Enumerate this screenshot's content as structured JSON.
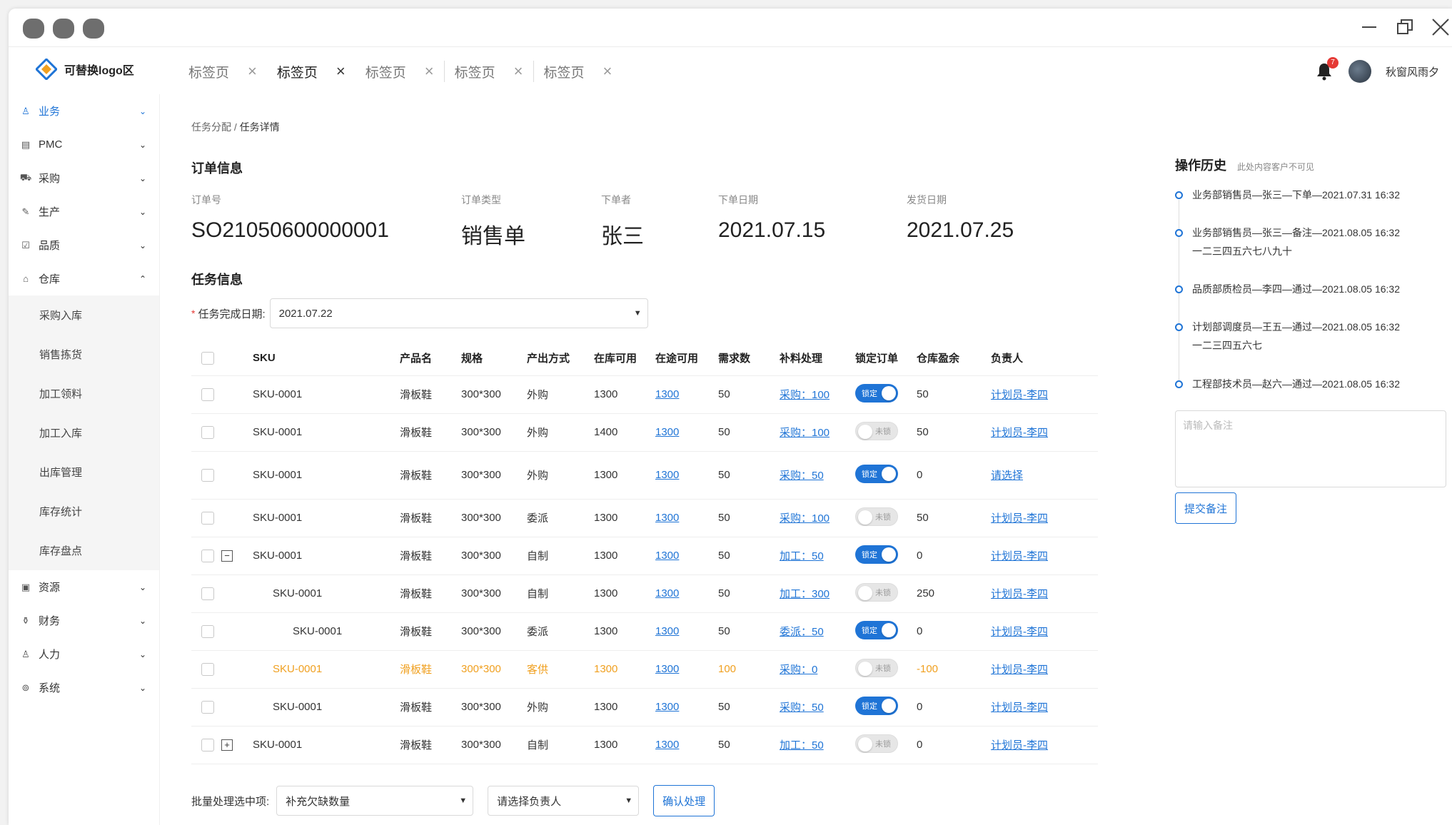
{
  "header": {
    "logo_text": "可替换logo区",
    "tabs": [
      {
        "label": "标签页",
        "active": false
      },
      {
        "label": "标签页",
        "active": true
      },
      {
        "label": "标签页",
        "active": false
      },
      {
        "label": "标签页",
        "active": false
      },
      {
        "label": "标签页",
        "active": false
      }
    ],
    "notification_count": "7",
    "username": "秋窗风雨夕"
  },
  "sidebar": {
    "items": [
      {
        "label": "业务",
        "icon": "user-group-icon"
      },
      {
        "label": "PMC",
        "icon": "pmc-icon"
      },
      {
        "label": "采购",
        "icon": "cart-icon"
      },
      {
        "label": "生产",
        "icon": "tool-icon"
      },
      {
        "label": "品质",
        "icon": "quality-icon"
      },
      {
        "label": "仓库",
        "icon": "warehouse-icon"
      },
      {
        "label": "资源",
        "icon": "resource-icon"
      },
      {
        "label": "财务",
        "icon": "money-icon"
      },
      {
        "label": "人力",
        "icon": "person-icon"
      },
      {
        "label": "系统",
        "icon": "settings-icon"
      }
    ],
    "warehouse_sub": [
      "采购入库",
      "销售拣货",
      "加工领料",
      "加工入库",
      "出库管理",
      "库存统计",
      "库存盘点"
    ]
  },
  "breadcrumb": {
    "parent": "任务分配",
    "sep": "/",
    "current": "任务详情"
  },
  "order": {
    "section_title": "订单信息",
    "labels": {
      "order_no": "订单号",
      "type": "订单类型",
      "orderer": "下单者",
      "order_date": "下单日期",
      "ship_date": "发货日期"
    },
    "values": {
      "order_no": "SO21050600000001",
      "type": "销售单",
      "orderer": "张三",
      "order_date": "2021.07.15",
      "ship_date": "2021.07.25"
    }
  },
  "task": {
    "section_title": "任务信息",
    "required_mark": "*",
    "date_label": "任务完成日期:",
    "date_value": "2021.07.22"
  },
  "table": {
    "headers": [
      "SKU",
      "产品名",
      "规格",
      "产出方式",
      "在库可用",
      "在途可用",
      "需求数",
      "补料处理",
      "锁定订单",
      "仓库盈余",
      "负责人"
    ],
    "lock_on": "锁定",
    "lock_off": "未锁",
    "rows": [
      {
        "sku": "SKU-0001",
        "name": "滑板鞋",
        "spec": "300*300",
        "method": "外购",
        "stock": "1300",
        "transit": "1300",
        "demand": "50",
        "supply": "采购：100",
        "locked": true,
        "surplus": "50",
        "owner": "计划员-李四"
      },
      {
        "sku": "SKU-0001",
        "name": "滑板鞋",
        "spec": "300*300",
        "method": "外购",
        "stock": "1400",
        "transit": "1300",
        "demand": "50",
        "supply": "采购：100",
        "locked": false,
        "surplus": "50",
        "owner": "计划员-李四"
      },
      {
        "sku": "SKU-0001",
        "name": "滑板鞋",
        "spec": "300*300",
        "method": "外购",
        "stock": "1300",
        "transit": "1300",
        "demand": "50",
        "supply": "采购：50",
        "locked": true,
        "surplus": "0",
        "owner": "请选择"
      },
      {
        "sku": "SKU-0001",
        "name": "滑板鞋",
        "spec": "300*300",
        "method": "委派",
        "stock": "1300",
        "transit": "1300",
        "demand": "50",
        "supply": "采购：100",
        "locked": false,
        "surplus": "50",
        "owner": "计划员-李四"
      },
      {
        "sku": "SKU-0001",
        "name": "滑板鞋",
        "spec": "300*300",
        "method": "自制",
        "stock": "1300",
        "transit": "1300",
        "demand": "50",
        "supply": "加工：50",
        "locked": true,
        "surplus": "0",
        "owner": "计划员-李四"
      },
      {
        "sku": "SKU-0001",
        "name": "滑板鞋",
        "spec": "300*300",
        "method": "自制",
        "stock": "1300",
        "transit": "1300",
        "demand": "50",
        "supply": "加工：300",
        "locked": false,
        "surplus": "250",
        "owner": "计划员-李四"
      },
      {
        "sku": "SKU-0001",
        "name": "滑板鞋",
        "spec": "300*300",
        "method": "委派",
        "stock": "1300",
        "transit": "1300",
        "demand": "50",
        "supply": "委派：50",
        "locked": true,
        "surplus": "0",
        "owner": "计划员-李四"
      },
      {
        "sku": "SKU-0001",
        "name": "滑板鞋",
        "spec": "300*300",
        "method": "客供",
        "stock": "1300",
        "transit": "1300",
        "demand": "100",
        "supply": "采购：0",
        "locked": false,
        "surplus": "-100",
        "owner": "计划员-李四"
      },
      {
        "sku": "SKU-0001",
        "name": "滑板鞋",
        "spec": "300*300",
        "method": "外购",
        "stock": "1300",
        "transit": "1300",
        "demand": "50",
        "supply": "采购：50",
        "locked": true,
        "surplus": "0",
        "owner": "计划员-李四"
      },
      {
        "sku": "SKU-0001",
        "name": "滑板鞋",
        "spec": "300*300",
        "method": "自制",
        "stock": "1300",
        "transit": "1300",
        "demand": "50",
        "supply": "加工：50",
        "locked": false,
        "surplus": "0",
        "owner": "计划员-李四"
      }
    ],
    "expander_minus": "−",
    "expander_plus": "+"
  },
  "batch": {
    "label": "批量处理选中项:",
    "action_select": "补充欠缺数量",
    "owner_select": "请选择负责人",
    "confirm": "确认处理"
  },
  "history": {
    "title": "操作历史",
    "note": "此处内容客户不可见",
    "entries": [
      {
        "text": "业务部销售员—张三—下单—2021.07.31 16:32"
      },
      {
        "text": "业务部销售员—张三—备注—2021.08.05 16:32",
        "extra": "一二三四五六七八九十"
      },
      {
        "text": "品质部质检员—李四—通过—2021.08.05 16:32"
      },
      {
        "text": "计划部调度员—王五—通过—2021.08.05 16:32",
        "extra": "一二三四五六七"
      },
      {
        "text": "工程部技术员—赵六—通过—2021.08.05 16:32"
      }
    ],
    "remark_placeholder": "请输入备注",
    "submit": "提交备注"
  },
  "colors": {
    "accent": "#1f74d6",
    "warning": "#f0a020",
    "danger": "#e53935"
  }
}
